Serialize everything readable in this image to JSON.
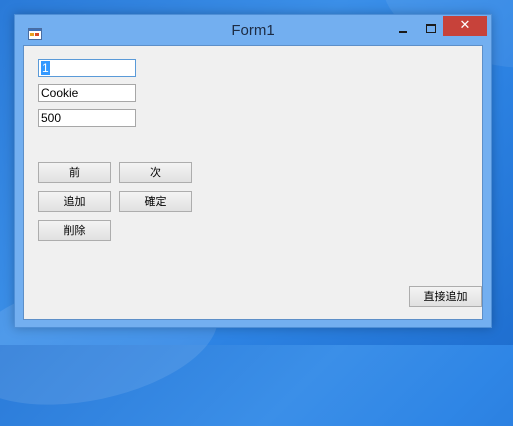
{
  "window": {
    "title": "Form1",
    "close_glyph": "✕"
  },
  "form": {
    "field1_value": "1",
    "field2_value": "Cookie",
    "field3_value": "500"
  },
  "buttons": {
    "prev_label": "前",
    "next_label": "次",
    "add_label": "追加",
    "confirm_label": "確定",
    "delete_label": "削除",
    "direct_add_label": "直接追加"
  },
  "colors": {
    "desktop": "#2f86e6",
    "titlebar": "#73aff0",
    "close_button": "#c7423a",
    "client_bg": "#f0f0f0",
    "selection": "#3399ff"
  },
  "icons": {
    "app": "form-app-icon",
    "minimize": "minimize-icon",
    "maximize": "maximize-icon",
    "close": "close-icon"
  }
}
